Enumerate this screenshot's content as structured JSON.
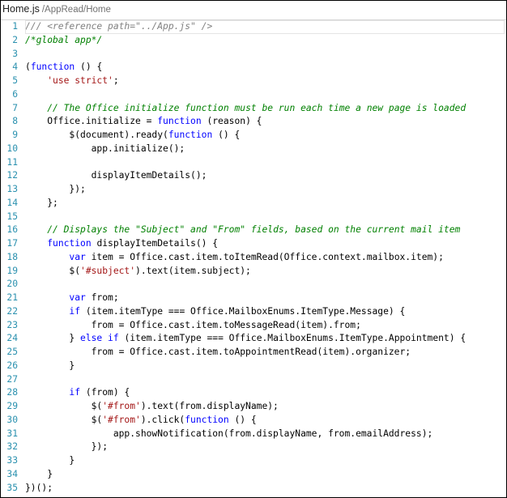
{
  "tab": {
    "filename": "Home.js",
    "path": "/AppRead/Home"
  },
  "colors": {
    "keyword": "#0000ff",
    "string": "#a31515",
    "comment": "#008000",
    "line_number": "#2b91af"
  },
  "current_line": 1,
  "lines": [
    [
      [
        "doc",
        "/// <reference path=\"../App.js\" />"
      ]
    ],
    [
      [
        "com",
        "/*global app*/"
      ]
    ],
    [],
    [
      [
        "p",
        "("
      ],
      [
        "kw",
        "function"
      ],
      [
        "p",
        " () {"
      ]
    ],
    [
      [
        "p",
        "    "
      ],
      [
        "str",
        "'use strict'"
      ],
      [
        "p",
        ";"
      ]
    ],
    [],
    [
      [
        "p",
        "    "
      ],
      [
        "com",
        "// The Office initialize function must be run each time a new page is loaded"
      ]
    ],
    [
      [
        "p",
        "    Office.initialize = "
      ],
      [
        "kw",
        "function"
      ],
      [
        "p",
        " (reason) {"
      ]
    ],
    [
      [
        "p",
        "        $(document).ready("
      ],
      [
        "kw",
        "function"
      ],
      [
        "p",
        " () {"
      ]
    ],
    [
      [
        "p",
        "            app.initialize();"
      ]
    ],
    [],
    [
      [
        "p",
        "            displayItemDetails();"
      ]
    ],
    [
      [
        "p",
        "        });"
      ]
    ],
    [
      [
        "p",
        "    };"
      ]
    ],
    [],
    [
      [
        "p",
        "    "
      ],
      [
        "com",
        "// Displays the \"Subject\" and \"From\" fields, based on the current mail item"
      ]
    ],
    [
      [
        "p",
        "    "
      ],
      [
        "kw",
        "function"
      ],
      [
        "p",
        " displayItemDetails() {"
      ]
    ],
    [
      [
        "p",
        "        "
      ],
      [
        "kw",
        "var"
      ],
      [
        "p",
        " item = Office.cast.item.toItemRead(Office.context.mailbox.item);"
      ]
    ],
    [
      [
        "p",
        "        $("
      ],
      [
        "str",
        "'#subject'"
      ],
      [
        "p",
        ").text(item.subject);"
      ]
    ],
    [],
    [
      [
        "p",
        "        "
      ],
      [
        "kw",
        "var"
      ],
      [
        "p",
        " from;"
      ]
    ],
    [
      [
        "p",
        "        "
      ],
      [
        "kw",
        "if"
      ],
      [
        "p",
        " (item.itemType === Office.MailboxEnums.ItemType.Message) {"
      ]
    ],
    [
      [
        "p",
        "            from = Office.cast.item.toMessageRead(item).from;"
      ]
    ],
    [
      [
        "p",
        "        } "
      ],
      [
        "kw",
        "else"
      ],
      [
        "p",
        " "
      ],
      [
        "kw",
        "if"
      ],
      [
        "p",
        " (item.itemType === Office.MailboxEnums.ItemType.Appointment) {"
      ]
    ],
    [
      [
        "p",
        "            from = Office.cast.item.toAppointmentRead(item).organizer;"
      ]
    ],
    [
      [
        "p",
        "        }"
      ]
    ],
    [],
    [
      [
        "p",
        "        "
      ],
      [
        "kw",
        "if"
      ],
      [
        "p",
        " (from) {"
      ]
    ],
    [
      [
        "p",
        "            $("
      ],
      [
        "str",
        "'#from'"
      ],
      [
        "p",
        ").text(from.displayName);"
      ]
    ],
    [
      [
        "p",
        "            $("
      ],
      [
        "str",
        "'#from'"
      ],
      [
        "p",
        ").click("
      ],
      [
        "kw",
        "function"
      ],
      [
        "p",
        " () {"
      ]
    ],
    [
      [
        "p",
        "                app.showNotification(from.displayName, from.emailAddress);"
      ]
    ],
    [
      [
        "p",
        "            });"
      ]
    ],
    [
      [
        "p",
        "        }"
      ]
    ],
    [
      [
        "p",
        "    }"
      ]
    ],
    [
      [
        "p",
        "})();"
      ]
    ]
  ]
}
